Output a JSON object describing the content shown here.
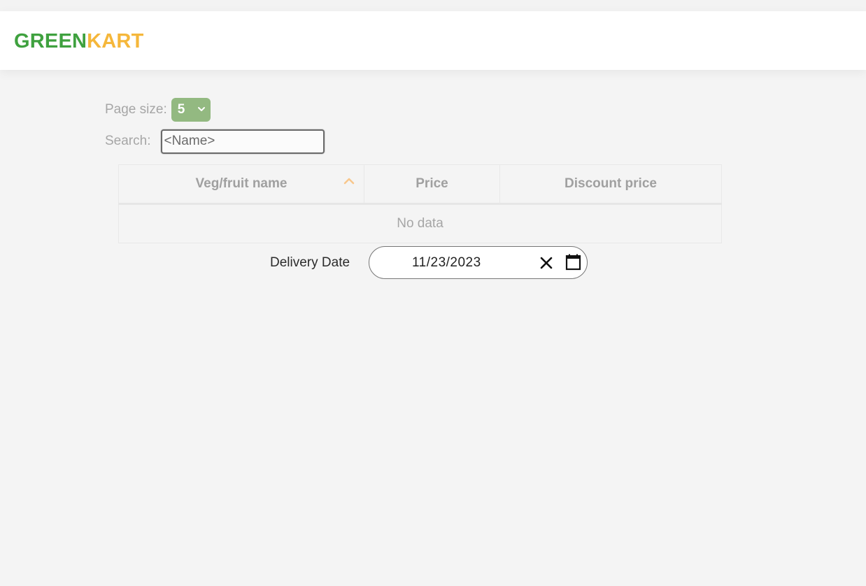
{
  "brand": {
    "part1": "GREEN",
    "part2": "KART"
  },
  "controls": {
    "page_size_label": "Page size:",
    "page_size_value": "5",
    "search_label": "Search:",
    "search_value": "<Name>"
  },
  "table": {
    "columns": [
      "Veg/fruit name",
      "Price",
      "Discount price"
    ],
    "sorted_column": "Veg/fruit name",
    "sort_direction": "ascending",
    "empty_message": "No data"
  },
  "delivery": {
    "label": "Delivery Date",
    "value": "11/23/2023"
  },
  "icons": {
    "page_size_dropdown": "chevron-down-icon",
    "sort_indicator": "chevron-up-icon",
    "clear_date": "close-icon",
    "open_calendar": "calendar-icon"
  },
  "colors": {
    "brand_green": "#3fa13f",
    "brand_orange": "#f5b73b",
    "select_bg": "#93b981",
    "sort_icon": "#f8c78c"
  }
}
